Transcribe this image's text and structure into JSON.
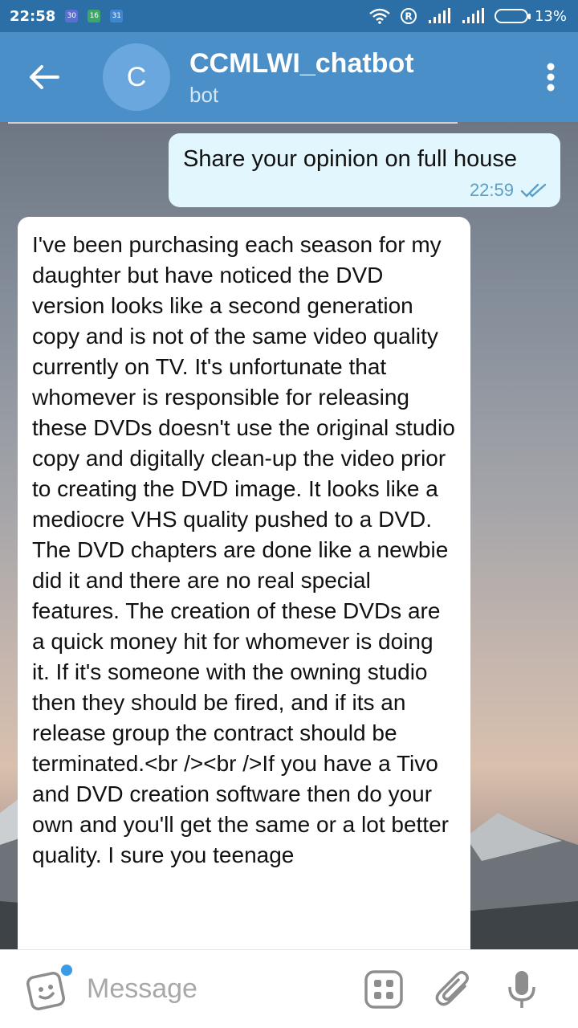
{
  "status_bar": {
    "time": "22:58",
    "notifications": [
      "30",
      "16",
      "31"
    ],
    "battery": "13%"
  },
  "header": {
    "back_icon": "arrow-left-icon",
    "avatar_letter": "C",
    "title": "CCMLWI_chatbot",
    "subtitle": "bot",
    "menu_icon": "more-vertical-icon"
  },
  "messages": [
    {
      "direction": "outgoing",
      "text": "Share your opinion on full house",
      "time": "22:59",
      "status_icon": "double-check-icon"
    },
    {
      "direction": "incoming",
      "text": "I've been purchasing each season for my daughter but have noticed the DVD version looks like a second generation copy and is not of the same video quality currently on TV. It's unfortunate that whomever is responsible for releasing these DVDs doesn't use the original studio copy and digitally clean-up the video prior to creating the DVD image. It looks like a mediocre VHS quality pushed to a DVD. The DVD chapters are done like a newbie did it and there are no real special features. The creation of these DVDs are a quick money hit for whomever is doing it. If it's someone with the owning studio then they should be fired, and if its an release group the contract should be terminated.<br /><br />If you have a Tivo and DVD creation software then do your own and you'll get the same or a lot better quality. I sure you teenage"
    }
  ],
  "input_bar": {
    "placeholder": "Message",
    "icons": [
      "sticker-icon",
      "bot-commands-icon",
      "attach-icon",
      "mic-icon"
    ]
  },
  "colors": {
    "header": "#4a8fc8",
    "status_bar": "#2b6fa6",
    "outgoing_bubble": "#e2f7fd",
    "incoming_bubble": "#ffffff",
    "accent": "#3a9ce6"
  }
}
